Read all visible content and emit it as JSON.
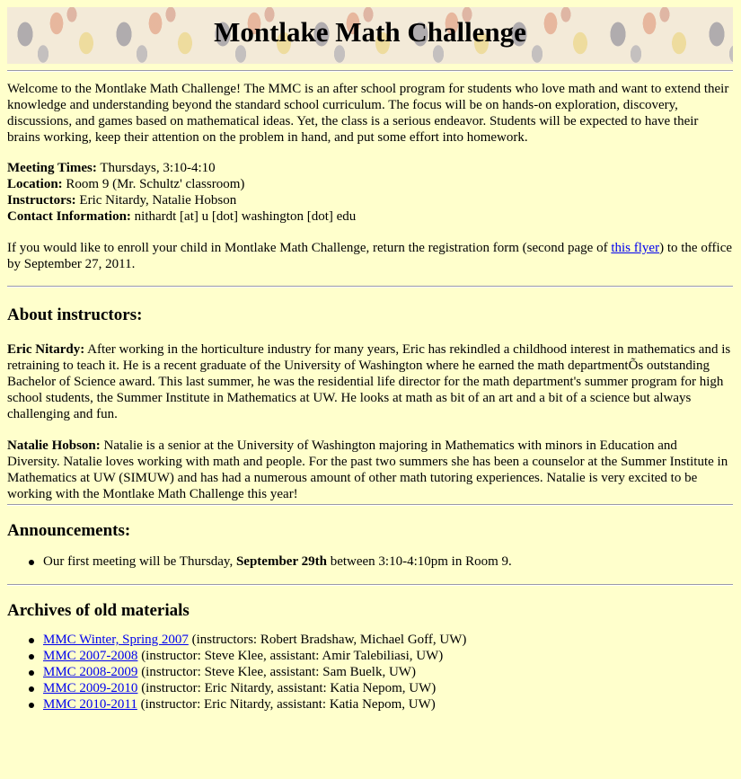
{
  "header": {
    "title": "Montlake Math Challenge"
  },
  "intro": {
    "text": "Welcome to the Montlake Math Challenge! The MMC is an after school program for students who love math and want to extend their knowledge and understanding beyond the standard school curriculum. The focus will be on hands-on exploration, discovery, discussions, and games based on mathematical ideas. Yet, the class is a serious endeavor. Students will be expected to have their brains working, keep their attention on the problem in hand, and put some effort into homework."
  },
  "info": {
    "meeting_label": "Meeting Times:",
    "meeting_value": " Thursdays, 3:10-4:10",
    "location_label": "Location:",
    "location_value": " Room 9 (Mr. Schultz' classroom)",
    "instructors_label": "Instructors:",
    "instructors_value": " Eric Nitardy, Natalie Hobson",
    "contact_label": "Contact Information:",
    "contact_value": " nithardt [at] u [dot] washington [dot] edu"
  },
  "enroll": {
    "before": "If you would like to enroll your child in Montlake Math Challenge, return the registration form (second page of ",
    "link": "this flyer",
    "after": ") to the office by September 27, 2011."
  },
  "about": {
    "heading": "About instructors:",
    "eric_name": "Eric Nitardy:",
    "eric_text": " After working in the horticulture industry for many years, Eric has rekindled a childhood interest in mathematics and is retraining to teach it. He is a recent graduate of the University of Washington where he earned the math departmentÕs outstanding Bachelor of Science award. This last summer, he was the residential life director for the math department's summer program for high school students, the Summer Institute in Mathematics at UW. He looks at math as bit of an art and a bit of a science but always challenging and fun.",
    "natalie_name": "Natalie Hobson:",
    "natalie_text": " Natalie is a senior at the University of Washington majoring in Mathematics with minors in Education and Diversity. Natalie loves working with math and people. For the past two summers she has been a counselor at the Summer Institute in Mathematics at UW (SIMUW) and has had a numerous amount of other math tutoring experiences. Natalie is very excited to be working with the Montlake Math Challenge this year!"
  },
  "announcements": {
    "heading": "Announcements:",
    "item_before": "Our first meeting will be Thursday, ",
    "item_bold": "September 29th",
    "item_after": " between 3:10-4:10pm in Room 9."
  },
  "archives": {
    "heading": "Archives of old materials",
    "items": [
      {
        "link": "MMC Winter, Spring 2007",
        "text": " (instructors: Robert Bradshaw, Michael Goff, UW)"
      },
      {
        "link": "MMC 2007-2008",
        "text": " (instructor: Steve Klee, assistant: Amir Talebiliasi, UW)"
      },
      {
        "link": "MMC 2008-2009",
        "text": " (instructor: Steve Klee, assistant: Sam Buelk, UW)"
      },
      {
        "link": "MMC 2009-2010",
        "text": " (instructor: Eric Nitardy, assistant: Katia Nepom, UW)"
      },
      {
        "link": "MMC 2010-2011",
        "text": " (instructor: Eric Nitardy, assistant: Katia Nepom, UW)"
      }
    ]
  },
  "colors": {
    "background": "#ffffcc",
    "link": "#0000ee",
    "rule": "#9a9aa8"
  }
}
